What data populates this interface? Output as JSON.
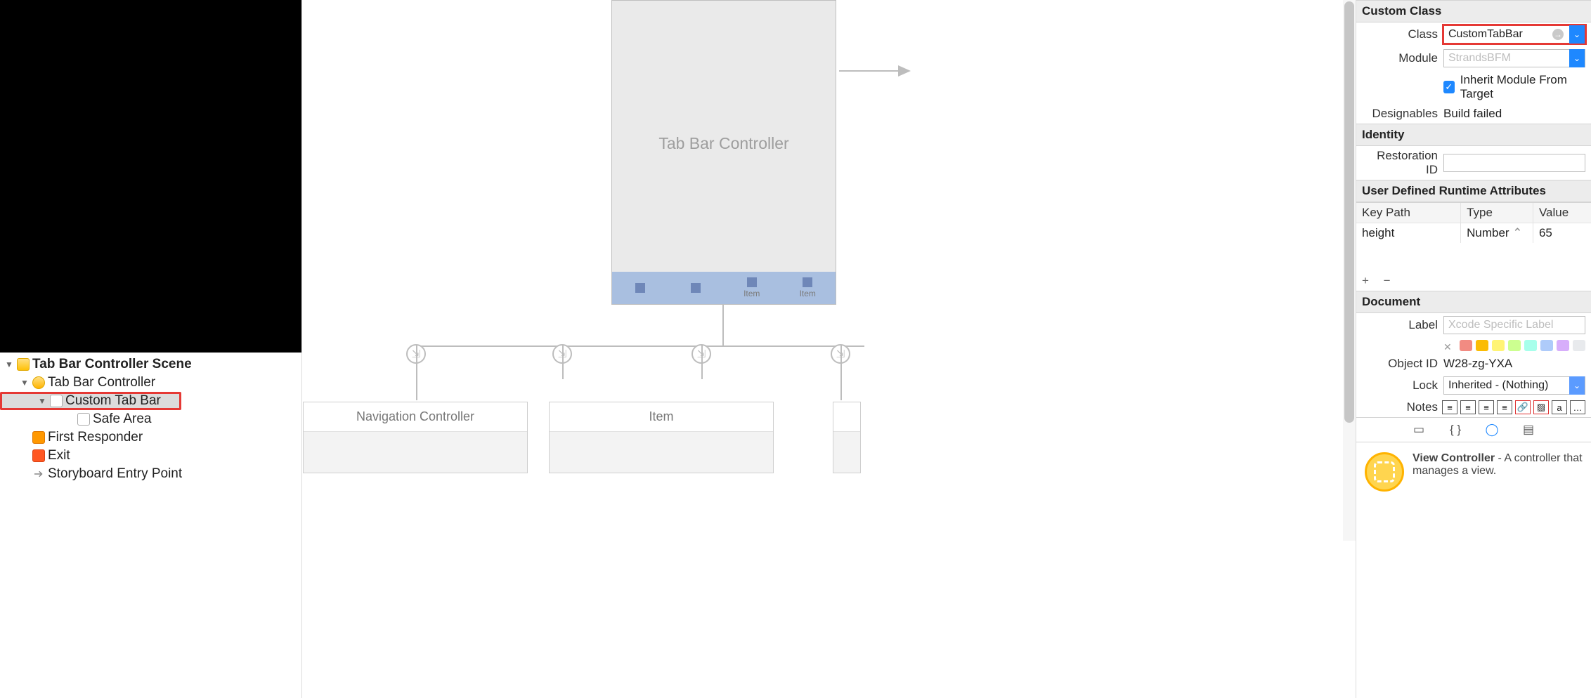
{
  "outline": {
    "scene": "Tab Bar Controller Scene",
    "items": {
      "tbc": "Tab Bar Controller",
      "custom": "Custom Tab Bar",
      "safe": "Safe Area",
      "first": "First Responder",
      "exit": "Exit",
      "entry": "Storyboard Entry Point"
    }
  },
  "canvas": {
    "tbc_title": "Tab Bar Controller",
    "tab_items": [
      "",
      "",
      "Item",
      "Item"
    ],
    "cards": {
      "nav": "Navigation Controller",
      "item": "Item"
    }
  },
  "inspector": {
    "custom_class": {
      "header": "Custom Class",
      "class_label": "Class",
      "class_value": "CustomTabBar",
      "module_label": "Module",
      "module_placeholder": "StrandsBFM",
      "inherit": "Inherit Module From Target",
      "designables_label": "Designables",
      "designables_value": "Build failed"
    },
    "identity": {
      "header": "Identity",
      "restoration_label": "Restoration ID"
    },
    "runtime": {
      "header": "User Defined Runtime Attributes",
      "cols": {
        "key": "Key Path",
        "type": "Type",
        "value": "Value"
      },
      "row": {
        "key": "height",
        "type": "Number",
        "value": "65"
      }
    },
    "document": {
      "header": "Document",
      "label_label": "Label",
      "label_placeholder": "Xcode Specific Label",
      "swatches": [
        "#f28b82",
        "#fbbc04",
        "#fff475",
        "#ccff90",
        "#a7ffeb",
        "#aecbfa",
        "#d7aefb",
        "#e8eaed"
      ],
      "object_id_label": "Object ID",
      "object_id_value": "W28-zg-YXA",
      "lock_label": "Lock",
      "lock_value": "Inherited - (Nothing)",
      "notes_label": "Notes"
    },
    "library": {
      "item_title": "View Controller",
      "item_desc": " - A controller that manages a view."
    }
  }
}
